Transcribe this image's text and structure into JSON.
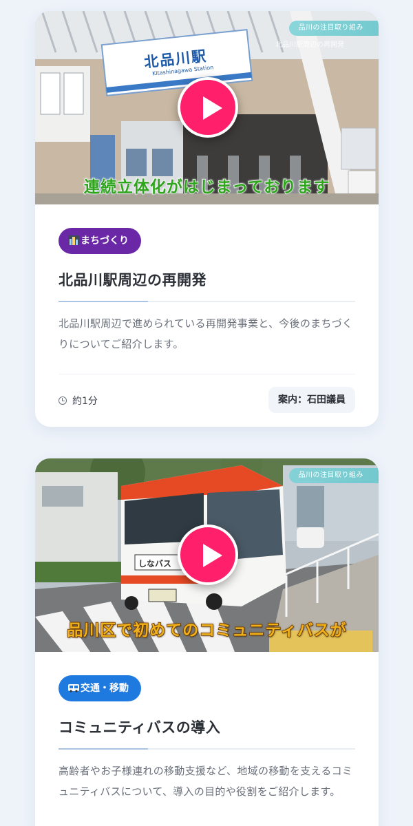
{
  "colors": {
    "page_background": "#eef3fa",
    "play_button": "#ff1f6a",
    "category_machizukuri": "#6a27a6",
    "category_transport": "#1f7ae0",
    "caption_1": "#2ea51c",
    "caption_2": "#f0b11a"
  },
  "cards": [
    {
      "overlay_tag": "品川の注目取り組み",
      "overlay_subtag": "北品川駅周辺の再開発",
      "station_sign": "北品川駅",
      "station_sign_romaji": "Kitashinagawa Station",
      "caption": "連続立体化がはじまっております",
      "category_icon": "city-icon",
      "category": "まちづくり",
      "title": "北品川駅周辺の再開発",
      "description": "北品川駅周辺で進められている再開発事業と、今後のまちづくりについてご紹介します。",
      "duration_icon": "clock-icon",
      "duration": "約1分",
      "guide": "案内：石田議員"
    },
    {
      "overlay_tag": "品川の注目取り組み",
      "bus_label": "しなバス",
      "caption": "品川区で初めてのコミュニティバスが",
      "category_icon": "bus-icon",
      "category": "交通・移動",
      "title": "コミュニティバスの導入",
      "description": "高齢者やお子様連れの移動支援など、地域の移動を支えるコミュニティバスについて、導入の目的や役割をご紹介します。"
    }
  ]
}
